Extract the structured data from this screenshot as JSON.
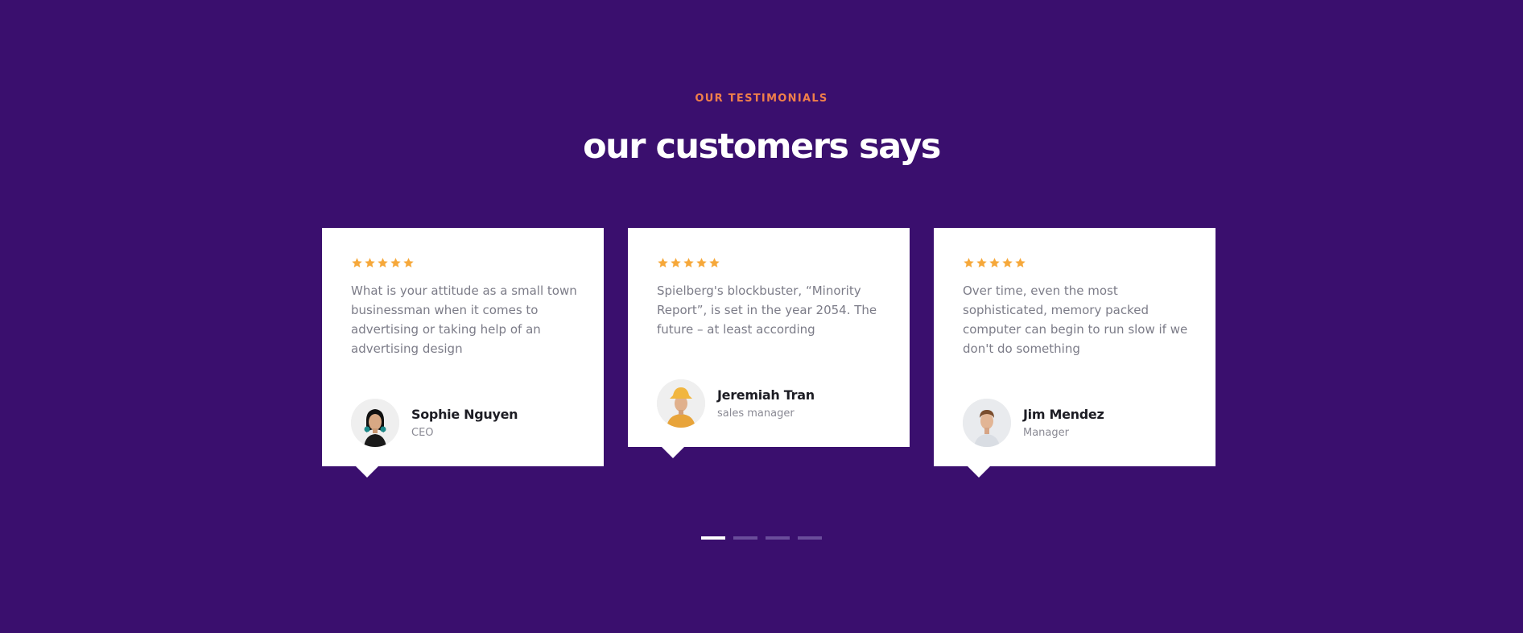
{
  "header": {
    "eyebrow": "OUR TESTIMONIALS",
    "title": "our customers says"
  },
  "colors": {
    "background": "#3a0f6e",
    "accent": "#f07f4a",
    "star": "#f6a83a",
    "card": "#ffffff"
  },
  "testimonials": [
    {
      "rating": 5,
      "quote": "What is your attitude as a small town businessman when it comes to advertising or taking help of an advertising design",
      "name": "Sophie Nguyen",
      "role": "CEO"
    },
    {
      "rating": 5,
      "quote": "Spielberg's blockbuster, “Minority Report”, is set in the year 2054. The future – at least according",
      "name": "Jeremiah Tran",
      "role": "sales manager"
    },
    {
      "rating": 5,
      "quote": "Over time, even the most sophisticated, memory packed computer can begin to run slow if we don't do something",
      "name": "Jim Mendez",
      "role": "Manager"
    }
  ],
  "pager": {
    "count": 4,
    "active_index": 0
  }
}
